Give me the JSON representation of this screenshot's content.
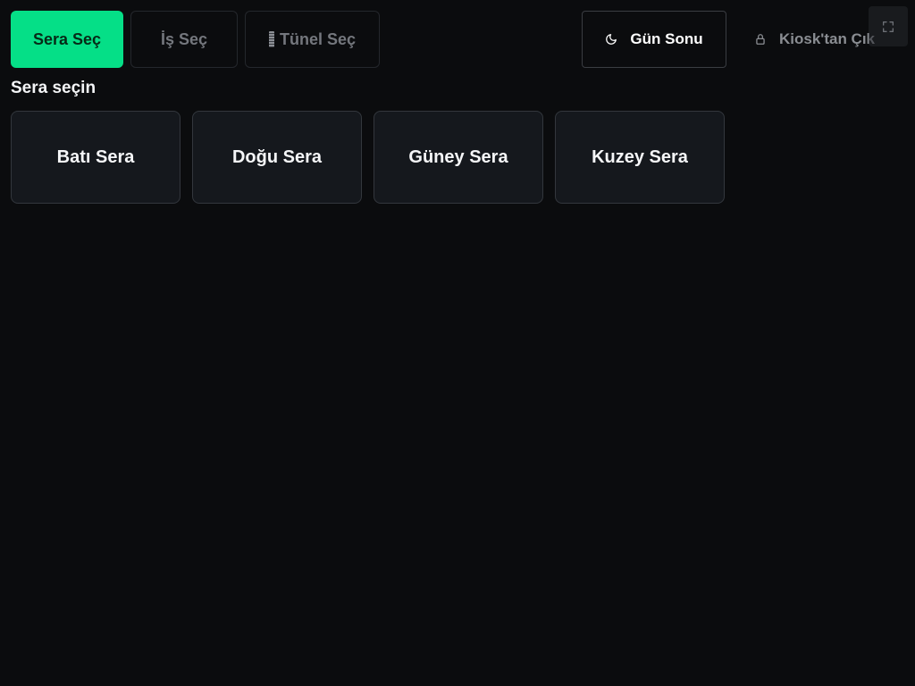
{
  "steps": [
    {
      "label": "Sera Seç",
      "state": "active"
    },
    {
      "label": "İş Seç",
      "state": "disabled"
    },
    {
      "label": "Tünel Seç",
      "state": "disabled"
    }
  ],
  "actions": {
    "day_end_label": "Gün Sonu",
    "day_end_icon": "moon-icon",
    "exit_kiosk_label": "Kiosk'tan Çık",
    "exit_kiosk_icon": "lock-icon",
    "fullscreen_icon": "fullscreen-icon"
  },
  "main": {
    "heading": "Sera seçin",
    "greenhouses": [
      "Batı Sera",
      "Doğu Sera",
      "Güney Sera",
      "Kuzey Sera"
    ]
  },
  "colors": {
    "background": "#0b0c0e",
    "accent": "#05df87",
    "card": "#15181d",
    "card_border": "#33373d",
    "muted_text": "#74777d"
  }
}
